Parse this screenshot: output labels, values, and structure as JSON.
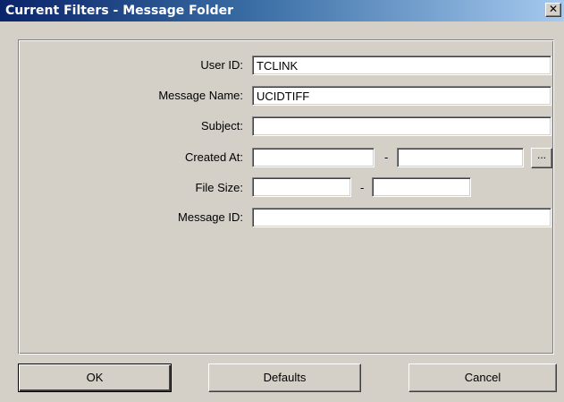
{
  "window": {
    "title": "Current Filters - Message Folder",
    "close_glyph": "✕"
  },
  "form": {
    "user_id": {
      "label": "User ID:",
      "value": "TCLINK"
    },
    "message_name": {
      "label": "Message Name:",
      "value": "UCIDTIFF"
    },
    "subject": {
      "label": "Subject:",
      "value": ""
    },
    "created_at": {
      "label": "Created At:",
      "from": "",
      "to": "",
      "separator": "-",
      "picker_label": "..."
    },
    "file_size": {
      "label": "File Size:",
      "from": "",
      "to": "",
      "separator": "-"
    },
    "message_id": {
      "label": "Message ID:",
      "value": ""
    }
  },
  "buttons": {
    "ok": "OK",
    "defaults": "Defaults",
    "cancel": "Cancel"
  }
}
